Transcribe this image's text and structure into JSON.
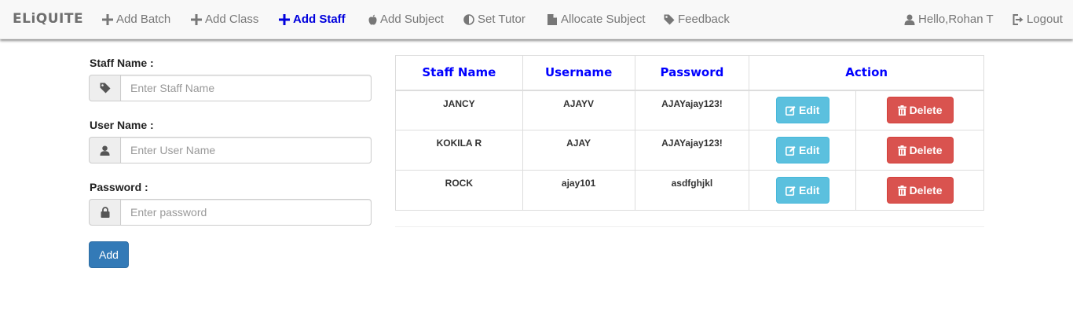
{
  "brand": "ELiQUITE",
  "nav": {
    "add_batch": "Add Batch",
    "add_class": "Add Class",
    "add_staff": "Add Staff",
    "add_subject": "Add Subject",
    "set_tutor": "Set Tutor",
    "allocate_subject": "Allocate Subject",
    "feedback": "Feedback",
    "user_greeting": "Hello,Rohan T",
    "logout": "Logout"
  },
  "form": {
    "staff_name_label": "Staff Name :",
    "staff_name_placeholder": "Enter Staff Name",
    "user_name_label": "User Name :",
    "user_name_placeholder": "Enter User Name",
    "password_label": "Password :",
    "password_placeholder": "Enter password",
    "add_button": "Add"
  },
  "table": {
    "headers": {
      "staff_name": "Staff Name",
      "username": "Username",
      "password": "Password",
      "action": "Action"
    },
    "edit_label": "Edit",
    "delete_label": "Delete",
    "rows": [
      {
        "staff_name": "JANCY",
        "username": "AJAYV",
        "password": "AJAYajay123!"
      },
      {
        "staff_name": "KOKILA R",
        "username": "AJAY",
        "password": "AJAYajay123!"
      },
      {
        "staff_name": "ROCK",
        "username": "ajay101",
        "password": "asdfghjkl"
      }
    ]
  },
  "colors": {
    "active_nav": "#0000dd",
    "header_text": "#0000ff",
    "primary": "#337ab7",
    "info": "#5bc0de",
    "danger": "#d9534f"
  },
  "icons": {
    "add_batch": "plus-icon",
    "add_class": "plus-icon",
    "add_staff": "plus-icon",
    "add_subject": "apple-icon",
    "set_tutor": "adjust-icon",
    "allocate_subject": "file-icon",
    "feedback": "tag-icon",
    "user": "user-icon",
    "logout": "logout-icon",
    "staff_addon": "tag-icon",
    "user_addon": "user-icon",
    "password_addon": "lock-icon",
    "edit": "edit-icon",
    "delete": "trash-icon"
  }
}
